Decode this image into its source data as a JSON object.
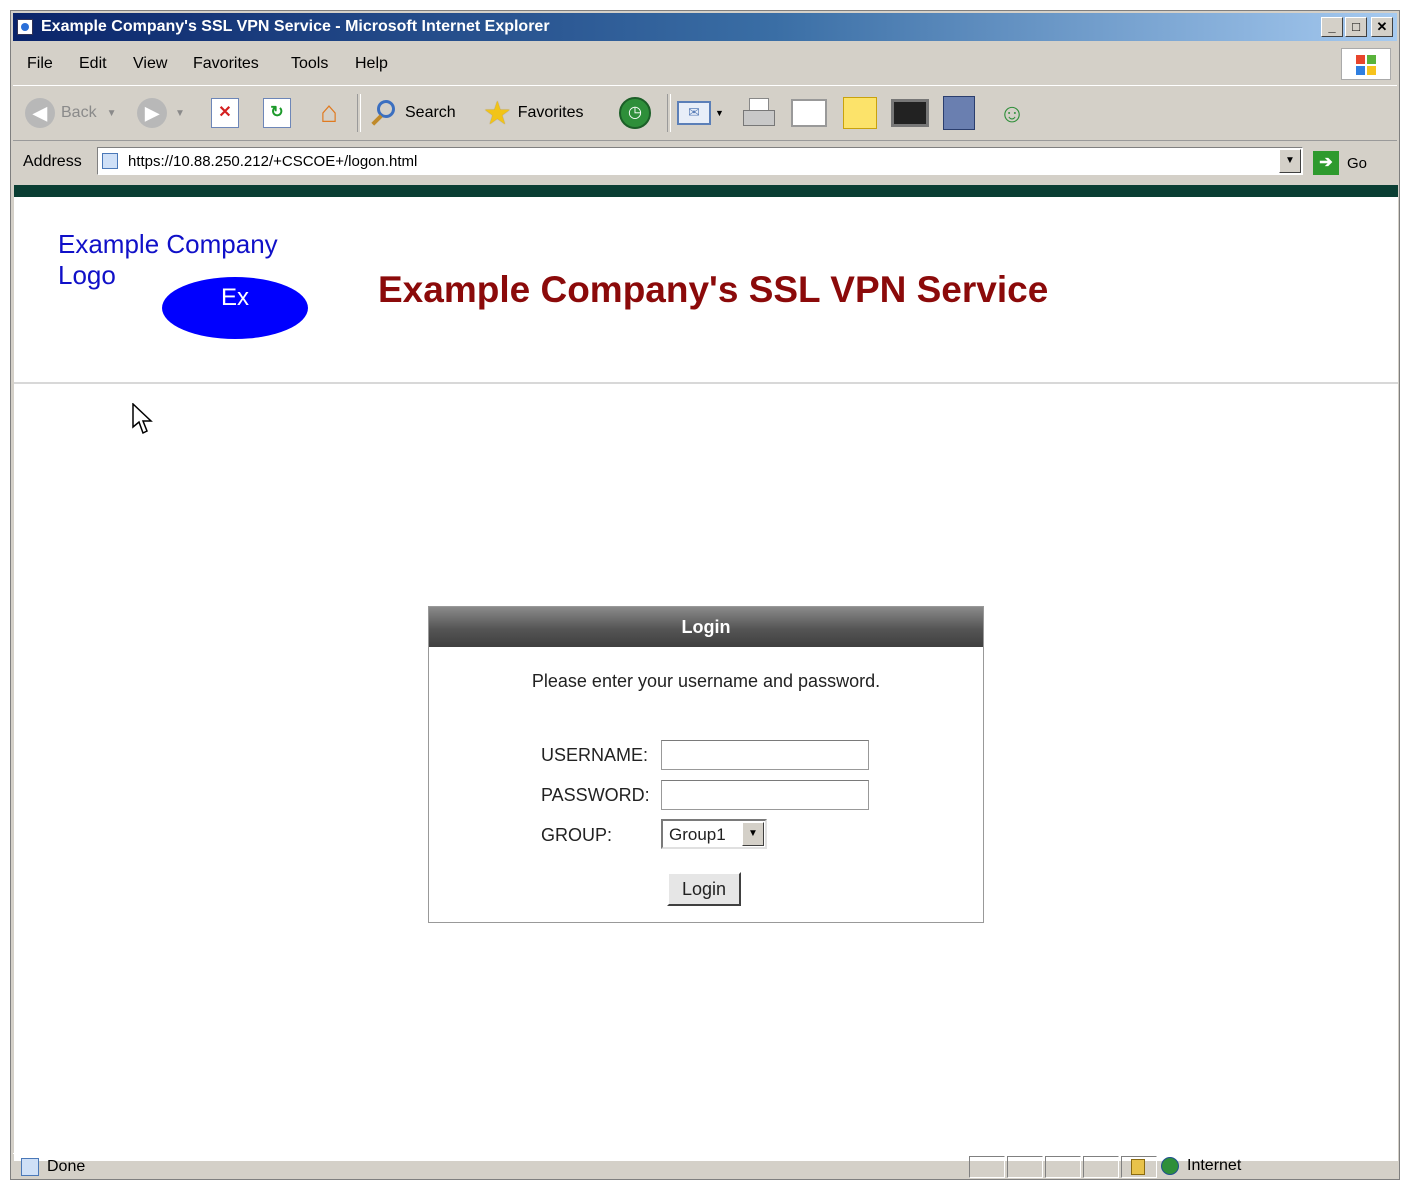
{
  "window": {
    "title": "Example Company's SSL VPN Service - Microsoft Internet Explorer",
    "minimize": "_",
    "maximize": "□",
    "close": "✕"
  },
  "menu": [
    "File",
    "Edit",
    "View",
    "Favorites",
    "Tools",
    "Help"
  ],
  "toolbar": {
    "back_label": "Back",
    "search_label": "Search",
    "favorites_label": "Favorites",
    "icons": [
      "back-icon",
      "forward-icon",
      "stop-icon",
      "refresh-icon",
      "home-icon",
      "search-icon",
      "favorites-star-icon",
      "history-icon",
      "mail-icon",
      "print-icon",
      "edit-icon",
      "discuss-icon",
      "messenger-icon",
      "research-icon",
      "msn-icon"
    ]
  },
  "address": {
    "label": "Address",
    "url": "https://10.88.250.212/+CSCOE+/logon.html",
    "go_label": "Go"
  },
  "page": {
    "logo_text_line1": "Example Company",
    "logo_text_line2": "Logo",
    "logo_badge": "Ex",
    "title": "Example Company's SSL VPN Service"
  },
  "login": {
    "header": "Login",
    "instruction": "Please enter your username and password.",
    "username_label": "USERNAME:",
    "username_value": "",
    "password_label": "PASSWORD:",
    "password_value": "",
    "group_label": "GROUP:",
    "group_selected": "Group1",
    "button_label": "Login"
  },
  "status": {
    "text": "Done",
    "zone": "Internet"
  },
  "colors": {
    "title_red": "#8b0a0a",
    "logo_blue": "#0000ff",
    "logo_text": "#1010c8",
    "stripe": "#0a3e33"
  }
}
